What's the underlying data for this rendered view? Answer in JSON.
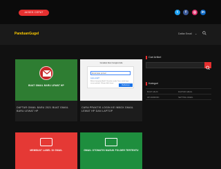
{
  "topbar": {
    "button_label": "AKSES CEPAT",
    "social": [
      {
        "icon": "twitter-icon",
        "glyph": "t"
      },
      {
        "icon": "facebook-icon",
        "glyph": "f"
      },
      {
        "icon": "instagram-icon",
        "glyph": "◎"
      },
      {
        "icon": "linkedin-icon",
        "glyph": "in"
      }
    ]
  },
  "header": {
    "brand": "PanduanGugel",
    "nav_link": "Daftar Email",
    "nav_chevron": "⌄"
  },
  "posts": [
    {
      "title": "DAFTAR GMAIL BARU 2021 BUAT GMAIL BARU LEWAT HP",
      "thumb_caption": "BUAT GMAIL BARU LEWAT HP"
    },
    {
      "title": "CARA PRAKTIS LOGIN KE INBOX GMAIL LEWAT HP DAN LAPTOP",
      "thumb_header": "Gunakan Akun Google Anda",
      "thumb_field": "Email atau ponsel",
      "thumb_link": "Lupa email?",
      "thumb_note": "Bukan komputer Anda? Gunakan mode Tamu untuk login secara pribadi. Pelajari lebih lanjut",
      "thumb_button": "Berikutnya"
    },
    {
      "thumb_caption": "MEMBUAT LABEL DI GMAIL"
    },
    {
      "thumb_caption": "GMAIL OTOMATIS MASUK FOLDER TERTENTU"
    }
  ],
  "sidebar": {
    "search_title": "Cari Artikel",
    "category_title": "Kategori",
    "tags": [
      "BUAT AKUN",
      "DAFTAR GMAIL",
      "HP ANDROID",
      "SETTING GMAIL"
    ]
  },
  "colors": {
    "accent": "#e63030",
    "brand": "#ffcc00",
    "background": "#111111"
  }
}
